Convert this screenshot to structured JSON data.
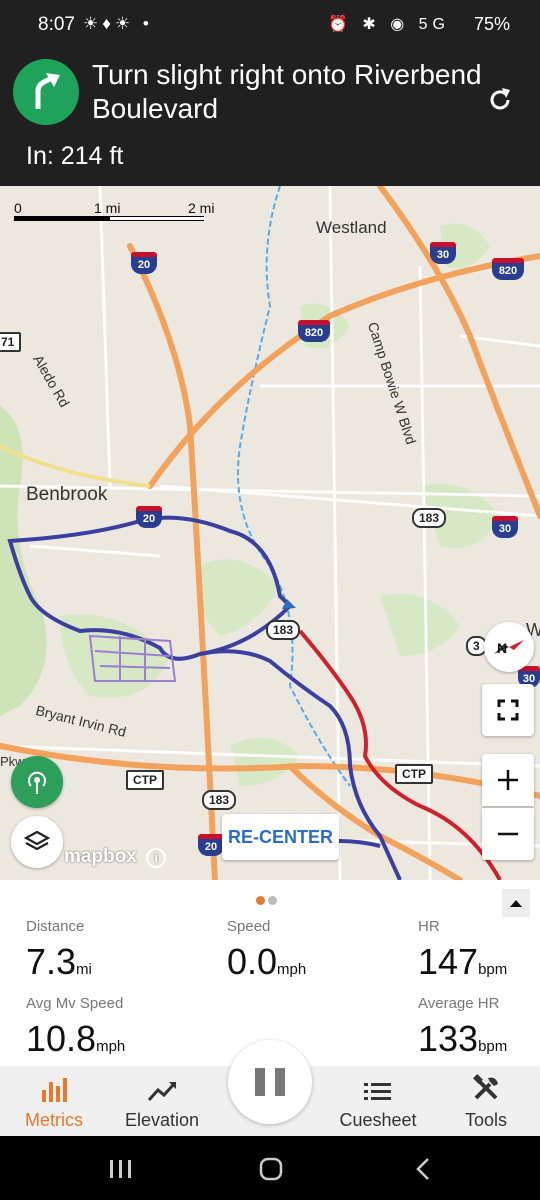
{
  "status": {
    "time": "8:07",
    "left_icons": "☀♦☀ •",
    "right_icons": "⏰ ✱ ◉ 5G",
    "battery": "75%"
  },
  "navigation": {
    "instruction": "Turn slight right onto Riverbend Boulevard",
    "distance_label": "In: 214 ft"
  },
  "map": {
    "scale": {
      "zero": "0",
      "one": "1 mi",
      "two": "2 mi"
    },
    "place_labels": {
      "westland": "Westland",
      "benbrook": "Benbrook",
      "aledo_rd": "Aledo Rd",
      "camp_bowie": "Camp Bowie W Blvd",
      "bryant_irvin": "Bryant Irvin Rd",
      "pkwy": "Pkwy",
      "edge_w": "W"
    },
    "shields": {
      "i20_a": "20",
      "i20_b": "20",
      "i20_c": "20",
      "i30_a": "30",
      "i30_b": "30",
      "i30_c": "30",
      "i820_a": "820",
      "i820_b": "820",
      "r183_a": "183",
      "r183_b": "183",
      "r183_c": "183",
      "ctp_a": "CTP",
      "ctp_b": "CTP",
      "edge_71": "71",
      "edge_3": "3"
    },
    "recenter_label": "RE-CENTER",
    "attribution": "mapbox"
  },
  "metrics": [
    {
      "label": "Distance",
      "value": "7.3",
      "unit": "mi"
    },
    {
      "label": "Speed",
      "value": "0.0",
      "unit": "mph"
    },
    {
      "label": "HR",
      "value": "147",
      "unit": "bpm"
    },
    {
      "label": "Avg Mv Speed",
      "value": "10.8",
      "unit": "mph"
    },
    {
      "label": "Average HR",
      "value": "133",
      "unit": "bpm"
    }
  ],
  "tabs": [
    {
      "label": "Metrics",
      "icon": "bar-chart-icon",
      "active": true
    },
    {
      "label": "Elevation",
      "icon": "trend-line-icon",
      "active": false
    },
    {
      "label": "Cuesheet",
      "icon": "list-icon",
      "active": false
    },
    {
      "label": "Tools",
      "icon": "tools-icon",
      "active": false
    }
  ],
  "colors": {
    "accent": "#e8782a",
    "turn_green": "#1fa35a",
    "route_blue": "#3b3fa0",
    "route_red": "#d0202a",
    "recenter_blue": "#2b6cc4"
  }
}
